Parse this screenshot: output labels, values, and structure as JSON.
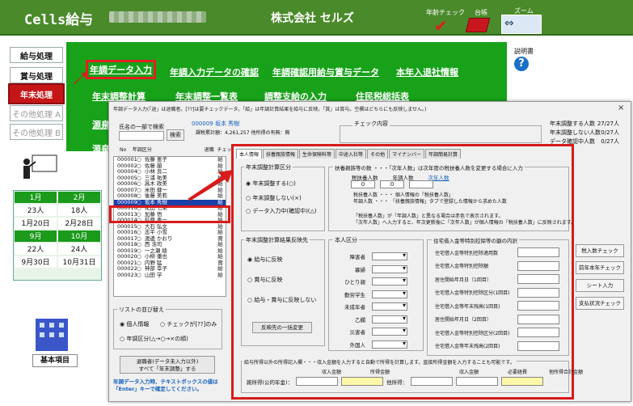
{
  "app": {
    "title": "Cells給与",
    "company": "株式会社 セルズ"
  },
  "header": {
    "nencho_check_label": "年齢チェック",
    "daicho_label": "台帳",
    "zoom_label": "ズーム",
    "help_label": "説明書"
  },
  "left_nav": [
    "給与処理",
    "賞与処理",
    "年末処理",
    "その他処理 A",
    "その他処理 B"
  ],
  "green_menu": {
    "nencho_input": "年調データ入力",
    "input_check": "年調入力データの確認",
    "kakunin": "年調確認用給与賞与データ",
    "taishoku": "本年入退社情報",
    "keisan": "年末調整計算",
    "ichiran": "年末調整一覧表",
    "shikyu": "調整支給の入力",
    "jumin": "住民税総括表",
    "gensen1": "源泉",
    "gensen2": "源泉"
  },
  "calendar": {
    "rows": [
      [
        "1月",
        "2月"
      ],
      [
        "23人",
        "18人"
      ],
      [
        "1月20日",
        "2月28日"
      ],
      [
        "9月",
        "10月"
      ],
      [
        "22人",
        "24人"
      ],
      [
        "9月30日",
        "10月31日"
      ]
    ]
  },
  "kihon_label": "基本項目",
  "dialog": {
    "title": "年調データ入力(「退」は退職者。[??]は要チェックデータ。「給」は年調計算結果を給与に反映。「賞」は賞与。空欄はどちらにも反映しません。)",
    "close": "×",
    "name_search_label": "氏名の一部で検索",
    "search_button": "検索",
    "employee_header": "000009  坂本 秀樹",
    "employee_sub": "課税累計額：4,261,257  他所得の有無：無",
    "check_label": "チェック内容",
    "summary": [
      [
        "年末調整する人数",
        "27/27人"
      ],
      [
        "年末調整しない人数",
        "0/27人"
      ],
      [
        "データ確認中人数",
        "0/27人"
      ]
    ],
    "list_header": "No    年調区分                                  退職  チェック  反映先",
    "employees": [
      [
        "000001",
        "○",
        "佐藤 恵子",
        "給"
      ],
      [
        "000002",
        "○",
        "佐藤 蘭",
        "給"
      ],
      [
        "000004",
        "○",
        "小林 良二",
        "給"
      ],
      [
        "000005",
        "○",
        "三浦 祐美",
        "給"
      ],
      [
        "000006",
        "○",
        "高木 政美",
        "給"
      ],
      [
        "000007",
        "○",
        "米田 健一",
        "給"
      ],
      [
        "000008",
        "○",
        "後藤 美莉",
        "給"
      ],
      [
        "000009",
        "○",
        "坂本 秀樹",
        "給"
      ],
      [
        "000010",
        "○",
        "花田 七菜",
        "給"
      ],
      [
        "000013",
        "○",
        "加藤 悟",
        "給"
      ],
      [
        "000014",
        "○",
        "荻原 勇一",
        "給"
      ],
      [
        "000015",
        "○",
        "大石 弘文",
        "給"
      ],
      [
        "000016",
        "○",
        "志平 小雪",
        "給"
      ],
      [
        "000017",
        "○",
        "渡邊 かおり",
        "賞"
      ],
      [
        "000018",
        "○",
        "西 浩司",
        "給"
      ],
      [
        "000019",
        "○",
        "一之瀬 綾",
        "給"
      ],
      [
        "000020",
        "○",
        "小柳 徹也",
        "給"
      ],
      [
        "000021",
        "○",
        "内野 猛",
        "賞"
      ],
      [
        "000022",
        "○",
        "神部 幸子",
        "給"
      ],
      [
        "000023",
        "○",
        "山田 学",
        "給"
      ]
    ],
    "sort": {
      "title": "リストの並び替え",
      "opt1": "個人情報",
      "opt2": "チェックが[??]のみ",
      "opt3": "年調区分(△→○→×の順)"
    },
    "all_button": "退職者(データ未入力以外)\nすべて「年末調整」する",
    "note": "年調データ入力時、テキストボックスの値は「Enter」キーで確定してください。",
    "right_buttons": [
      "税入数チェック",
      "前年本年チェック",
      "シート入力",
      "支払状況チェック"
    ],
    "tabs": [
      "本人情報",
      "扶養親族情報",
      "生命保険料等",
      "中途入社等",
      "その他",
      "マイナンバー",
      "年調簡易計算"
    ],
    "calc_group": {
      "title": "年末調整計算区分",
      "opt1": "年末調整する(○)",
      "opt2": "年末調整しない(×)",
      "opt3": "データ入力中(確認中)(△)"
    },
    "fuyo_group": {
      "title": "扶養親族等の数 ・・・「次年人数」は次年度の税扶養人数を変更する場合に入力",
      "heads": [
        "税扶養人数",
        "年調人数",
        "次年人数"
      ],
      "values": [
        "0",
        "0",
        ""
      ],
      "line1": "税扶養人数  ・・・  個人情報の「税扶養人数」",
      "line2": "年調人数   ・・・  「扶養親族情報」タブで登録した情報から求めた人数",
      "note1": "「税扶養人数」が「年調人数」と異なる場合は赤色で表示されます。",
      "note2": "「次年人数」へ入力すると、年次更新後に「次年人数」が個人情報の「税扶養人数」に反映されます。"
    },
    "refl_group": {
      "title": "年末調整計算結果反映先",
      "opt1": "給与に反映",
      "opt2": "賞与に反映",
      "opt3": "給与・賞与に反映しない",
      "button": "反映先の一括変更"
    },
    "hon_group": {
      "title": "本人区分",
      "items": [
        "障害者",
        "寡婦",
        "ひとり親",
        "勤労学生",
        "未成年者",
        "乙欄",
        "災害者",
        "外国人"
      ]
    },
    "jutaku_group": {
      "title": "住宅借入金等特別控除等の額の内訳",
      "items": [
        "住宅借入金等特別控除適用数",
        "住宅借入金等特別控除額",
        "居住開始年月日（1回目）",
        "住宅借入金等特別控除区分(1回目)",
        "住宅借入金等年末残高(1回目)",
        "居住開始年月日（2回目）",
        "住宅借入金等特別控除区分(2回目)",
        "住宅借入金等年末残高(2回目)"
      ]
    },
    "extra_group": {
      "title": "給与所得以外の所得記入欄・・・収入金額を入力すると自動で所得を計算します。直接所得金額を入力することも可能です。",
      "heads": [
        "収入金額",
        "所得金額",
        "収入金額",
        "必要経費",
        "他所得合計金額"
      ],
      "row_label1": "雑所得(公的年金)：",
      "row_label2": "他所得："
    }
  },
  "colors": {
    "header_green": "#4a8a2a",
    "menu_green": "#18a21a",
    "highlight_red": "#d81b1b",
    "select_blue": "#1a3fa8"
  }
}
